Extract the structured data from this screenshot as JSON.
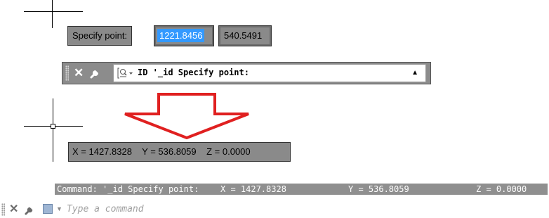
{
  "dynamic_input": {
    "label": "Specify point:",
    "x_value": "1221.8456",
    "y_value": "540.5491"
  },
  "command_bar": {
    "command_text": "ID '_id Specify point:",
    "dropdown_glyph": "▲",
    "close_glyph": "✕"
  },
  "coordinate_readout": {
    "x": "X = 1427.8328",
    "y": "Y = 536.8059",
    "z": "Z = 0.0000"
  },
  "history": {
    "command": "Command: '_id Specify point:",
    "x": "X = 1427.8328",
    "y": "Y = 536.8059",
    "z": "Z = 0.0000"
  },
  "bottom_command": {
    "placeholder": "Type a command",
    "close_glyph": "✕",
    "dropdown_glyph": "▼"
  },
  "colors": {
    "tooltip_bg": "#8a8a8a",
    "selection": "#3399ff",
    "arrow_red": "#e02020"
  },
  "icons": [
    "crosshair-icon",
    "close-icon",
    "wrench-icon",
    "command-prompt-icon",
    "dropdown-arrow-icon",
    "red-down-arrow-icon"
  ]
}
